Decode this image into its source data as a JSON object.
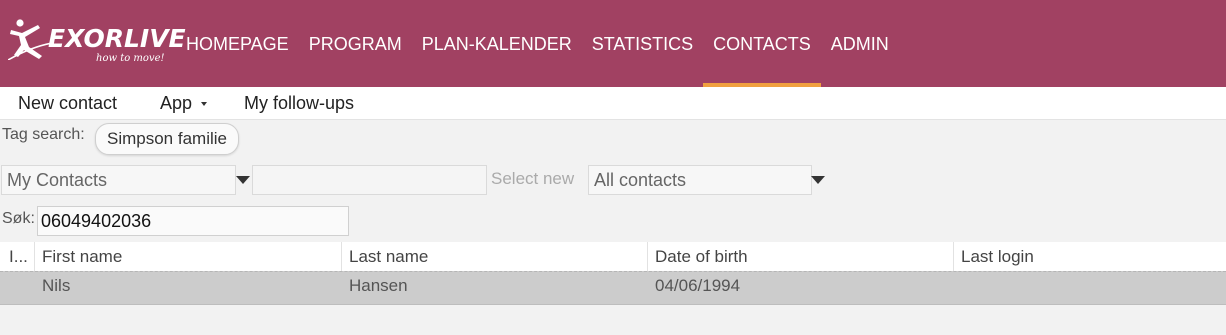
{
  "header": {
    "logo_brand": "EXORLIVE",
    "logo_tagline": "how to move!",
    "nav": [
      {
        "label": "HOMEPAGE",
        "active": false
      },
      {
        "label": "PROGRAM",
        "active": false
      },
      {
        "label": "PLAN-KALENDER",
        "active": false
      },
      {
        "label": "STATISTICS",
        "active": false
      },
      {
        "label": "CONTACTS",
        "active": true
      },
      {
        "label": "ADMIN",
        "active": false
      }
    ],
    "colors": {
      "background": "#a14162",
      "active_underline": "#f0a040"
    }
  },
  "submenu": {
    "new_contact": "New contact",
    "app": "App",
    "follow_ups": "My follow-ups"
  },
  "filters": {
    "tag_search_label": "Tag search:",
    "tag_chip": "Simpson familie",
    "contacts_select": "My Contacts",
    "select_new_label": "Select new",
    "all_contacts_select": "All contacts",
    "search_label": "Søk:",
    "search_value": "06049402036"
  },
  "table": {
    "columns": [
      "I...",
      "First name",
      "Last name",
      "Date of birth",
      "Last login"
    ],
    "rows": [
      {
        "first_name": "Nils",
        "last_name": "Hansen",
        "date_of_birth": "04/06/1994",
        "last_login": ""
      }
    ]
  }
}
